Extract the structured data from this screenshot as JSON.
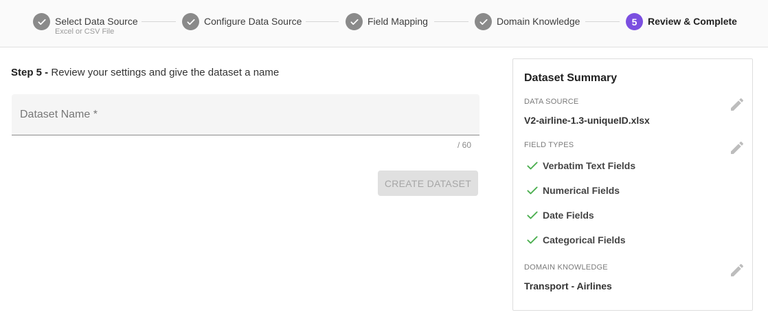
{
  "stepper": {
    "steps": [
      {
        "label": "Select Data Source",
        "sublabel": "Excel or CSV File",
        "state": "done"
      },
      {
        "label": "Configure Data Source",
        "state": "done"
      },
      {
        "label": "Field Mapping",
        "state": "done"
      },
      {
        "label": "Domain Knowledge",
        "state": "done"
      },
      {
        "label": "Review & Complete",
        "number": "5",
        "state": "active"
      }
    ]
  },
  "main": {
    "heading_prefix": "Step 5 -",
    "heading_text": " Review your settings and give the dataset a name",
    "name_field": {
      "placeholder": "Dataset Name *",
      "value": ""
    },
    "char_count": "/ 60",
    "create_button": "CREATE DATASET"
  },
  "summary": {
    "title": "Dataset Summary",
    "data_source_label": "DATA SOURCE",
    "data_source_value": "V2-airline-1.3-uniqueID.xlsx",
    "field_types_label": "FIELD TYPES",
    "field_types": [
      "Verbatim Text Fields",
      "Numerical Fields",
      "Date Fields",
      "Categorical Fields"
    ],
    "domain_label": "DOMAIN KNOWLEDGE",
    "domain_value": "Transport - Airlines"
  },
  "colors": {
    "accent": "#7b4fe0",
    "done_step": "#8a8a8a",
    "check": "#4caf50",
    "edit_icon": "#bdbdbd"
  },
  "icons": {
    "done_step": "check-icon",
    "edit": "pencil-icon",
    "field_type": "check-icon"
  }
}
